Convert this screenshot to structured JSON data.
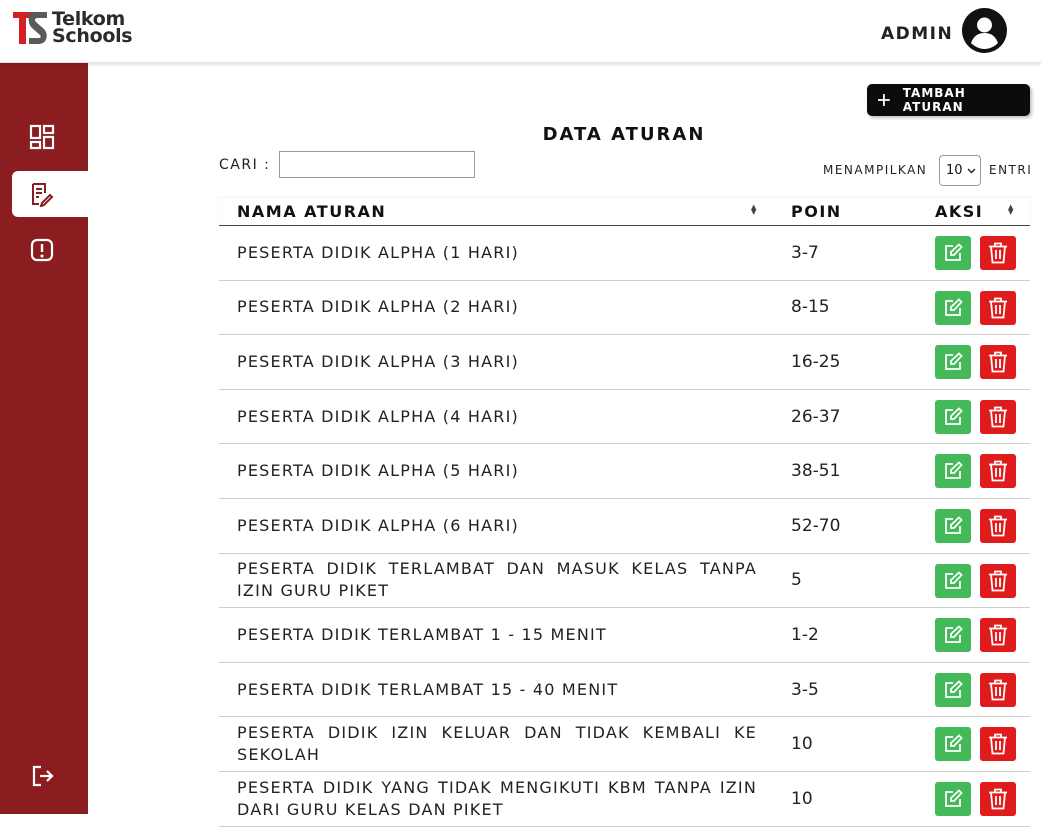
{
  "header": {
    "logo_line1": "Telkom",
    "logo_line2": "Schools",
    "user_label": "ADMIN"
  },
  "sidebar": {
    "items": [
      {
        "icon": "dashboard-icon",
        "active": false
      },
      {
        "icon": "rules-edit-icon",
        "active": true
      },
      {
        "icon": "alert-icon",
        "active": false
      }
    ],
    "logout_icon": "logout-icon"
  },
  "toolbar": {
    "add_label": "TAMBAH ATURAN"
  },
  "page": {
    "title": "DATA ATURAN"
  },
  "search": {
    "label": "CARI :",
    "value": ""
  },
  "pagination": {
    "show_label": "MENAMPILKAN",
    "page_size": "10",
    "entries_label": "ENTRI"
  },
  "table": {
    "columns": [
      "NAMA ATURAN",
      "POIN",
      "AKSI"
    ],
    "rows": [
      {
        "name": "PESERTA DIDIK ALPHA (1 HARI)",
        "poin": "3-7"
      },
      {
        "name": "PESERTA DIDIK ALPHA (2 HARI)",
        "poin": "8-15"
      },
      {
        "name": "PESERTA DIDIK ALPHA (3 HARI)",
        "poin": "16-25"
      },
      {
        "name": "PESERTA DIDIK ALPHA (4 HARI)",
        "poin": "26-37"
      },
      {
        "name": "PESERTA DIDIK ALPHA (5 HARI)",
        "poin": "38-51"
      },
      {
        "name": "PESERTA DIDIK ALPHA (6 HARI)",
        "poin": "52-70"
      },
      {
        "name": "PESERTA DIDIK TERLAMBAT DAN MASUK KELAS TANPA IZIN GURU PIKET",
        "poin": "5"
      },
      {
        "name": "PESERTA DIDIK TERLAMBAT 1 - 15 MENIT",
        "poin": "1-2"
      },
      {
        "name": "PESERTA DIDIK TERLAMBAT 15 - 40 MENIT",
        "poin": "3-5"
      },
      {
        "name": "PESERTA DIDIK IZIN KELUAR DAN TIDAK KEMBALI KE SEKOLAH",
        "poin": "10"
      },
      {
        "name": "PESERTA DIDIK YANG TIDAK MENGIKUTI KBM TANPA IZIN DARI GURU KELAS DAN PIKET",
        "poin": "10"
      }
    ]
  },
  "colors": {
    "sidebar": "#8b1c1f",
    "edit": "#44b95a",
    "delete": "#e01b1b",
    "primary_button": "#0c0c0c"
  }
}
